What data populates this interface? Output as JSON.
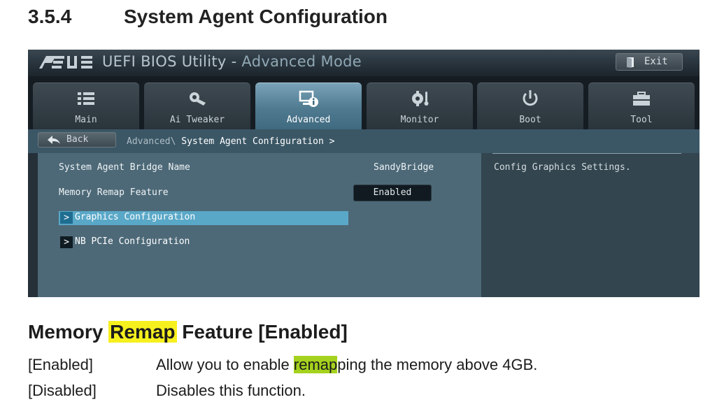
{
  "manual": {
    "section_number": "3.5.4",
    "section_title": "System Agent Configuration"
  },
  "bios": {
    "brand": "ASUS",
    "title_prefix": "UEFI BIOS Utility - ",
    "title_mode": "Advanced Mode",
    "exit_label": "Exit",
    "tabs": [
      {
        "label": "Main",
        "icon": "list-icon",
        "active": false
      },
      {
        "label": "Ai Tweaker",
        "icon": "tweaker-icon",
        "active": false
      },
      {
        "label": "Advanced",
        "icon": "advanced-icon",
        "active": true
      },
      {
        "label": "Monitor",
        "icon": "monitor-gear-icon",
        "active": false
      },
      {
        "label": "Boot",
        "icon": "power-icon",
        "active": false
      },
      {
        "label": "Tool",
        "icon": "toolbox-icon",
        "active": false
      }
    ],
    "back_label": "Back",
    "breadcrumb_parent": "Advanced\\ ",
    "breadcrumb_current": "System Agent Configuration >",
    "settings": {
      "bridge_name_label": "System Agent Bridge Name",
      "bridge_name_value": "SandyBridge",
      "memory_remap_label": "Memory Remap Feature",
      "memory_remap_value": "Enabled"
    },
    "submenus": [
      {
        "arrow": ">",
        "label": "Graphics Configuration",
        "selected": true
      },
      {
        "arrow": ">",
        "label": "NB PCIe Configuration",
        "selected": false
      }
    ],
    "help_text": "Config Graphics Settings.",
    "colors": {
      "selected_row": "#5aa8c8",
      "active_tab": "#4f7a90"
    }
  },
  "description": {
    "heading_before": "Memory ",
    "heading_highlight": "Remap",
    "heading_after": " Feature [Enabled]",
    "highlight_color": "#f6f01e",
    "options": [
      {
        "name": "[Enabled]",
        "desc_before": "Allow you to enable ",
        "desc_highlight": "remap",
        "desc_after": "ping the memory above 4GB."
      },
      {
        "name": "[Disabled]",
        "desc_before": "Disables this function.",
        "desc_highlight": "",
        "desc_after": ""
      }
    ],
    "option_highlight_color": "#a5d21e"
  }
}
